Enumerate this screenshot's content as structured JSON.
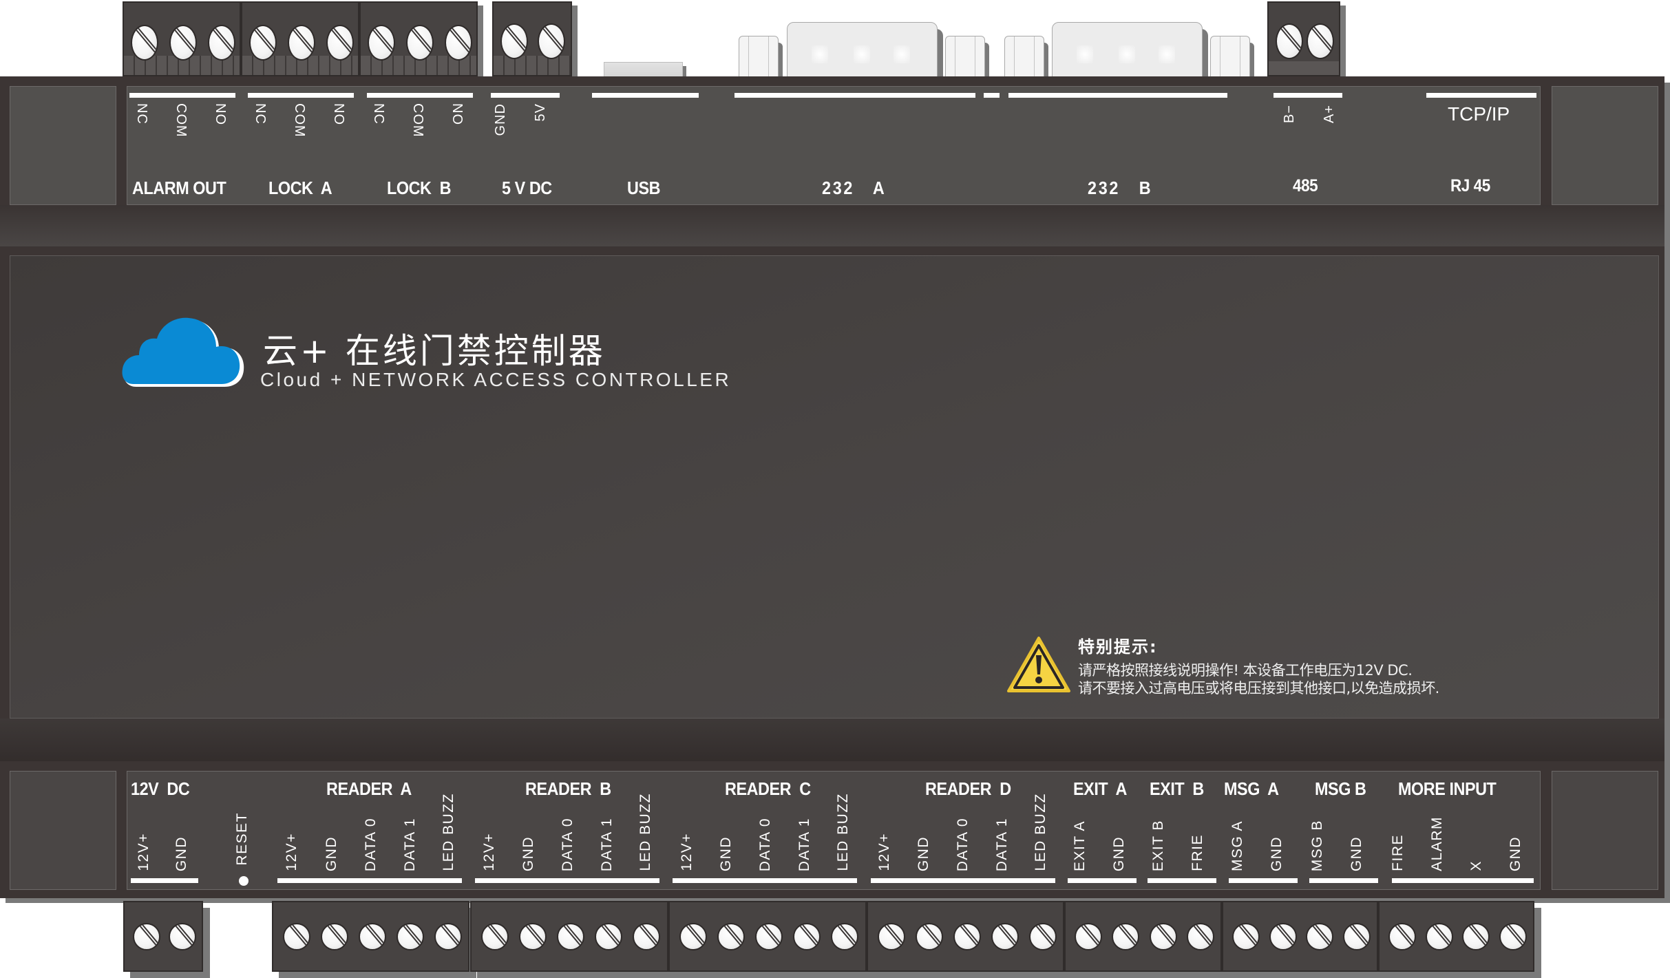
{
  "device": {
    "title_cn": "云+ 在线门禁控制器",
    "title_en": "Cloud + NETWORK ACCESS CONTROLLER",
    "brand_color": "#0a8ad4",
    "warning_color": "#f5d443"
  },
  "top_connectors": {
    "sections": [
      {
        "label": "ALARM OUT",
        "pins": [
          "NC",
          "COM",
          "NO"
        ]
      },
      {
        "label": "LOCK  A",
        "pins": [
          "NC",
          "COM",
          "NO"
        ]
      },
      {
        "label": "LOCK  B",
        "pins": [
          "NC",
          "COM",
          "NO"
        ]
      },
      {
        "label": "5 V DC",
        "pins": [
          "GND",
          "5V"
        ]
      },
      {
        "label": "USB",
        "pins": []
      },
      {
        "label": "232   A",
        "pins": []
      },
      {
        "label": "232   B",
        "pins": []
      },
      {
        "label": "485",
        "pins": [
          "B−",
          "A+"
        ]
      },
      {
        "label": "RJ 45",
        "pins": [],
        "sub_label": "TCP/IP"
      }
    ]
  },
  "warning": {
    "icon": "warning-triangle-icon",
    "title": "特别提示:",
    "lines": [
      "请严格按照接线说明操作! 本设备工作电压为12V DC.",
      "请不要接入过高电压或将电压接到其他接口,以免造成损坏."
    ]
  },
  "bottom_connectors": {
    "sections": [
      {
        "label": "12V  DC",
        "pins": [
          "12V+",
          "GND"
        ]
      },
      {
        "label": "RESET",
        "pins": []
      },
      {
        "label": "READER  A",
        "pins": [
          "12V+",
          "GND",
          "DATA 0",
          "DATA 1",
          "LED BUZZ"
        ]
      },
      {
        "label": "READER  B",
        "pins": [
          "12V+",
          "GND",
          "DATA 0",
          "DATA 1",
          "LED BUZZ"
        ]
      },
      {
        "label": "READER  C",
        "pins": [
          "12V+",
          "GND",
          "DATA 0",
          "DATA 1",
          "LED BUZZ"
        ]
      },
      {
        "label": "READER  D",
        "pins": [
          "12V+",
          "GND",
          "DATA 0",
          "DATA 1",
          "LED BUZZ"
        ]
      },
      {
        "label": "EXIT  A",
        "pins": [
          "EXIT A",
          "GND"
        ]
      },
      {
        "label": "EXIT  B",
        "pins": [
          "EXIT  B",
          "FRIE"
        ]
      },
      {
        "label": "MSG  A",
        "pins": [
          "MSG  A",
          "GND"
        ]
      },
      {
        "label": "MSG B",
        "pins": [
          "MSG  B",
          "GND"
        ]
      },
      {
        "label": "MORE INPUT",
        "pins": [
          "FIRE",
          "ALARM",
          "X",
          "GND"
        ]
      }
    ]
  }
}
